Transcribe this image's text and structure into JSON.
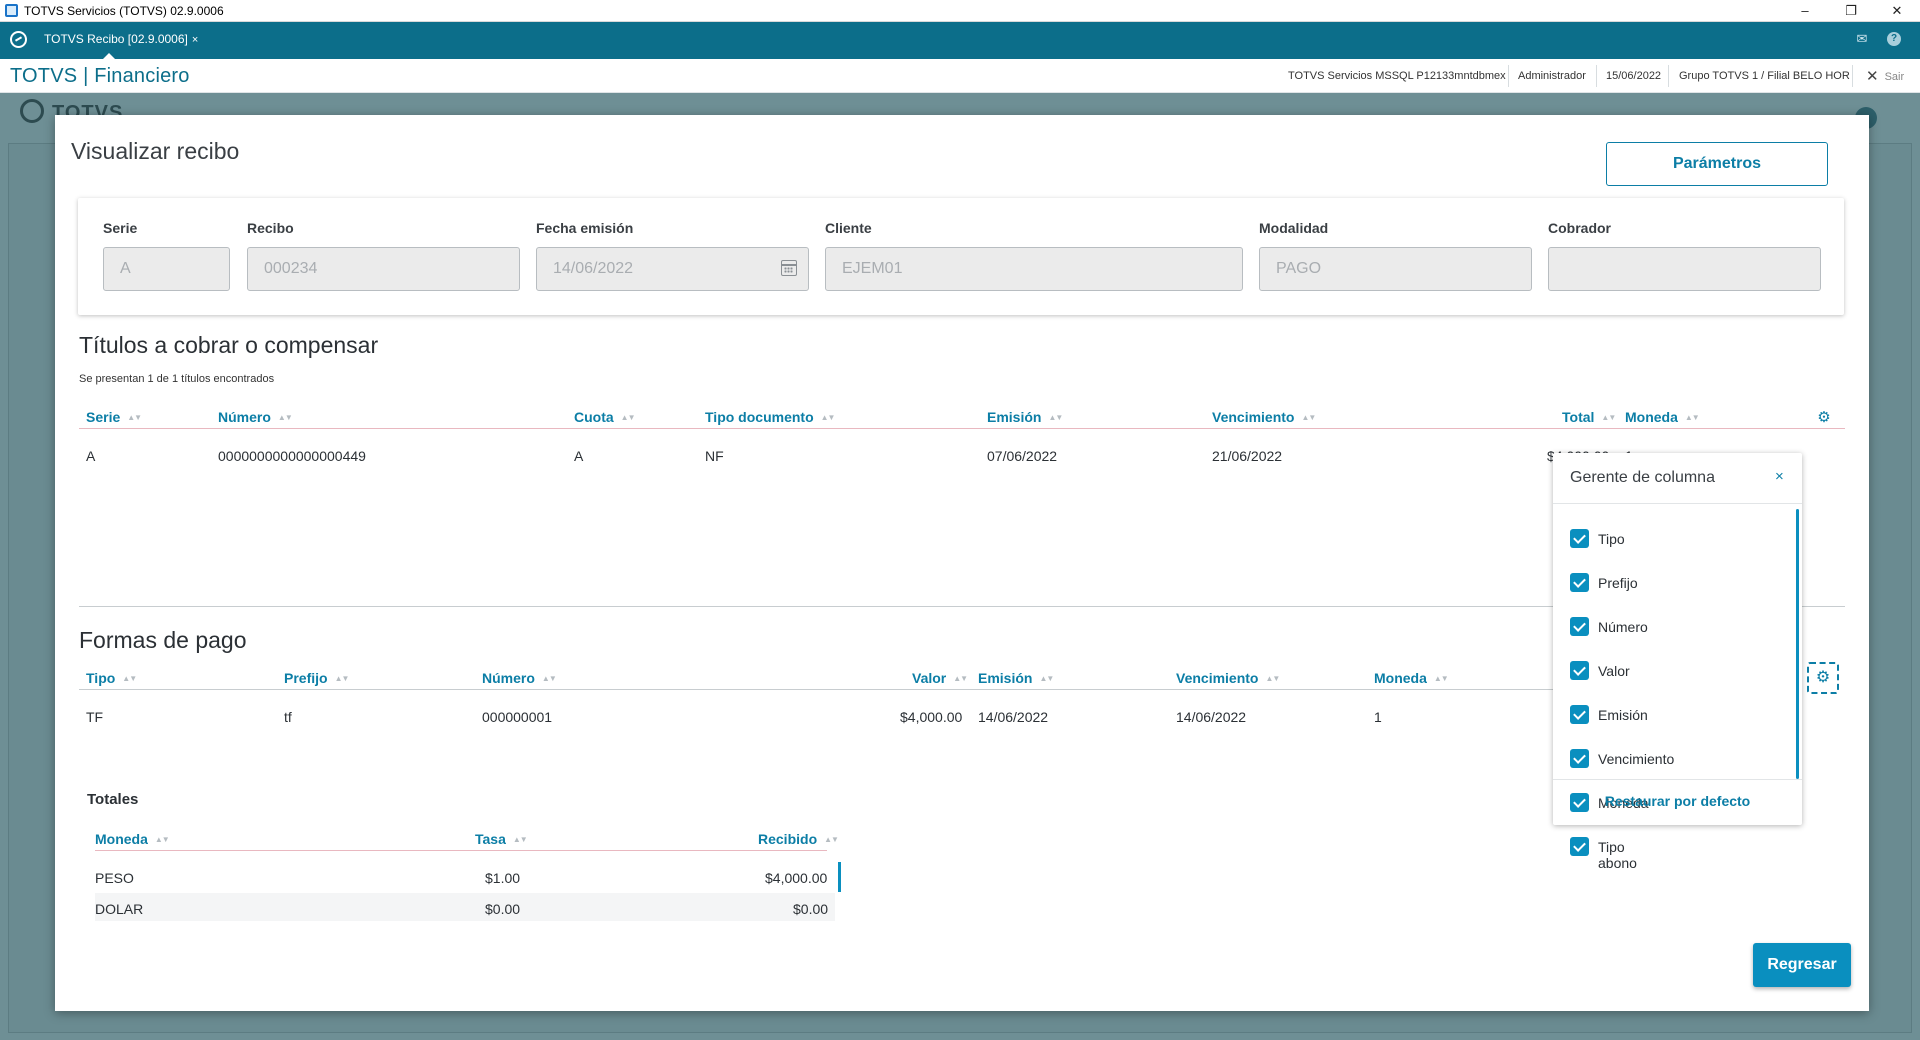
{
  "window": {
    "title": "TOTVS Servicios (TOTVS) 02.9.0006",
    "minimize": "–",
    "restore": "❐",
    "close": "✕"
  },
  "tabbar": {
    "tab_label": "TOTVS Recibo [02.9.0006]",
    "tab_close": "×",
    "mail_icon": "✉",
    "help_icon": "?"
  },
  "header": {
    "brand": "TOTVS | Financiero",
    "environment": "TOTVS Servicios MSSQL P12133mntdbmex",
    "user": "Administrador",
    "date": "15/06/2022",
    "branch": "Grupo TOTVS 1 / Filial BELO HOR",
    "exit_label": "Sair",
    "exit_icon": "✕"
  },
  "background": {
    "logo_text": "TOTVS"
  },
  "modal": {
    "title": "Visualizar recibo",
    "params_button": "Parámetros",
    "back_button": "Regresar",
    "fields": [
      {
        "label": "Serie",
        "value": "A"
      },
      {
        "label": "Recibo",
        "value": "000234"
      },
      {
        "label": "Fecha emisión",
        "value": "14/06/2022"
      },
      {
        "label": "Cliente",
        "value": "EJEM01"
      },
      {
        "label": "Modalidad",
        "value": "PAGO"
      },
      {
        "label": "Cobrador",
        "value": ""
      }
    ]
  },
  "titles_section": {
    "title": "Títulos a cobrar o compensar",
    "subtitle": "Se presentan 1 de 1 títulos encontrados",
    "columns": [
      "Serie",
      "Número",
      "Cuota",
      "Tipo documento",
      "Emisión",
      "Vencimiento",
      "Total",
      "Moneda"
    ],
    "rows": [
      [
        "A",
        "0000000000000000449",
        "A",
        "NF",
        "07/06/2022",
        "21/06/2022",
        "$4,000.00",
        "1"
      ]
    ],
    "sort_icon": "▲▼",
    "gear_icon": "⚙"
  },
  "payments_section": {
    "title": "Formas de pago",
    "columns": [
      "Tipo",
      "Prefijo",
      "Número",
      "Valor",
      "Emisión",
      "Vencimiento",
      "Moneda"
    ],
    "rows": [
      [
        "TF",
        "tf",
        "000000001",
        "$4,000.00",
        "14/06/2022",
        "14/06/2022",
        "1"
      ]
    ]
  },
  "totals_section": {
    "title": "Totales",
    "columns": [
      "Moneda",
      "Tasa",
      "Recibido"
    ],
    "rows": [
      [
        "PESO",
        "$1.00",
        "$4,000.00"
      ],
      [
        "DOLAR",
        "$0.00",
        "$0.00"
      ]
    ]
  },
  "column_manager": {
    "title": "Gerente de columna",
    "close_icon": "×",
    "items": [
      "Tipo",
      "Prefijo",
      "Número",
      "Valor",
      "Emisión",
      "Vencimiento",
      "Moneda",
      "Tipo abono"
    ],
    "restore": "Restaurar por defecto"
  },
  "colors": {
    "brand": "#0c6e8a",
    "accent": "#0a8fbf",
    "header_text": "#0c7ea6"
  }
}
